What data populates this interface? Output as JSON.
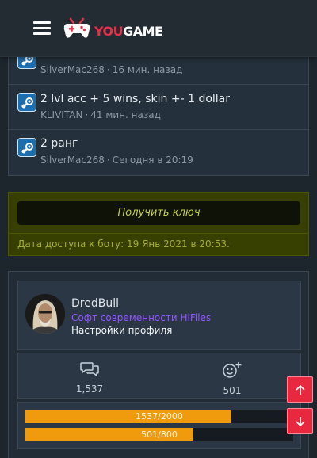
{
  "header": {
    "logo_you": "YOU",
    "logo_game": "GAME",
    "menu_icon": "hamburger-menu-icon"
  },
  "activity": {
    "rows": [
      {
        "title": "",
        "user": "SilverMac268",
        "separator": "·",
        "time": "16 мин. назад"
      },
      {
        "title": "2 lvl acc + 5 wins, skin +- 1 dollar",
        "user": "KLIVITAN",
        "separator": "·",
        "time": "41 мин. назад"
      },
      {
        "title": "2 ранг",
        "user": "SilverMac268",
        "separator": "·",
        "time": "Сегодня в 20:19"
      }
    ],
    "icon": "steam-icon"
  },
  "key_block": {
    "button_label": "Получить ключ",
    "access_note": "Дата доступа к боту: 19 Янв 2021 в 20:53."
  },
  "profile": {
    "username": "DredBull",
    "user_title": "Софт современности HiFiles",
    "settings_link": "Настройки профиля",
    "stats": [
      {
        "icon": "messages-icon",
        "value": "1,537"
      },
      {
        "icon": "reactions-icon",
        "value": "501"
      }
    ],
    "progress": [
      {
        "label": "1537/2000",
        "fraction": 0.7685
      },
      {
        "label": "501/800",
        "fraction": 0.626
      }
    ]
  },
  "floating": {
    "up_icon": "arrow-up-icon",
    "down_icon": "arrow-down-icon"
  },
  "colors": {
    "accent_red": "#e5314b",
    "progress_orange": "#f09a0e",
    "usertitle_purple": "#9255ff",
    "key_green": "#374000"
  }
}
